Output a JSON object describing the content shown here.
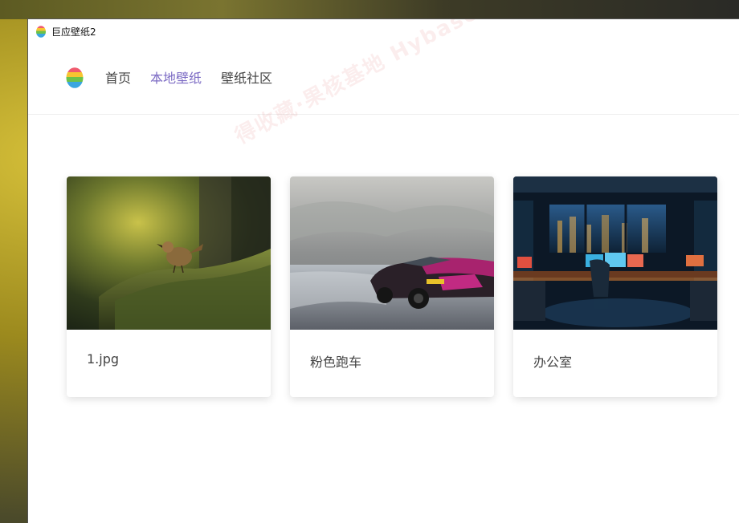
{
  "window": {
    "title": "巨应壁纸2",
    "app_icon": "rainbow-egg-icon"
  },
  "nav": {
    "logo": "rainbow-egg-logo",
    "items": [
      {
        "label": "首页",
        "active": false
      },
      {
        "label": "本地壁纸",
        "active": true
      },
      {
        "label": "壁纸社区",
        "active": false
      }
    ],
    "active_color": "#7c6bc4"
  },
  "wallpapers": [
    {
      "name": "1.jpg",
      "thumbnail": "bird-on-mossy-log"
    },
    {
      "name": "粉色跑车",
      "thumbnail": "pink-sports-car-on-snow"
    },
    {
      "name": "办公室",
      "thumbnail": "night-city-office-desk"
    }
  ],
  "watermark": {
    "text": "得收藏·果核基地  Hybase.com"
  }
}
